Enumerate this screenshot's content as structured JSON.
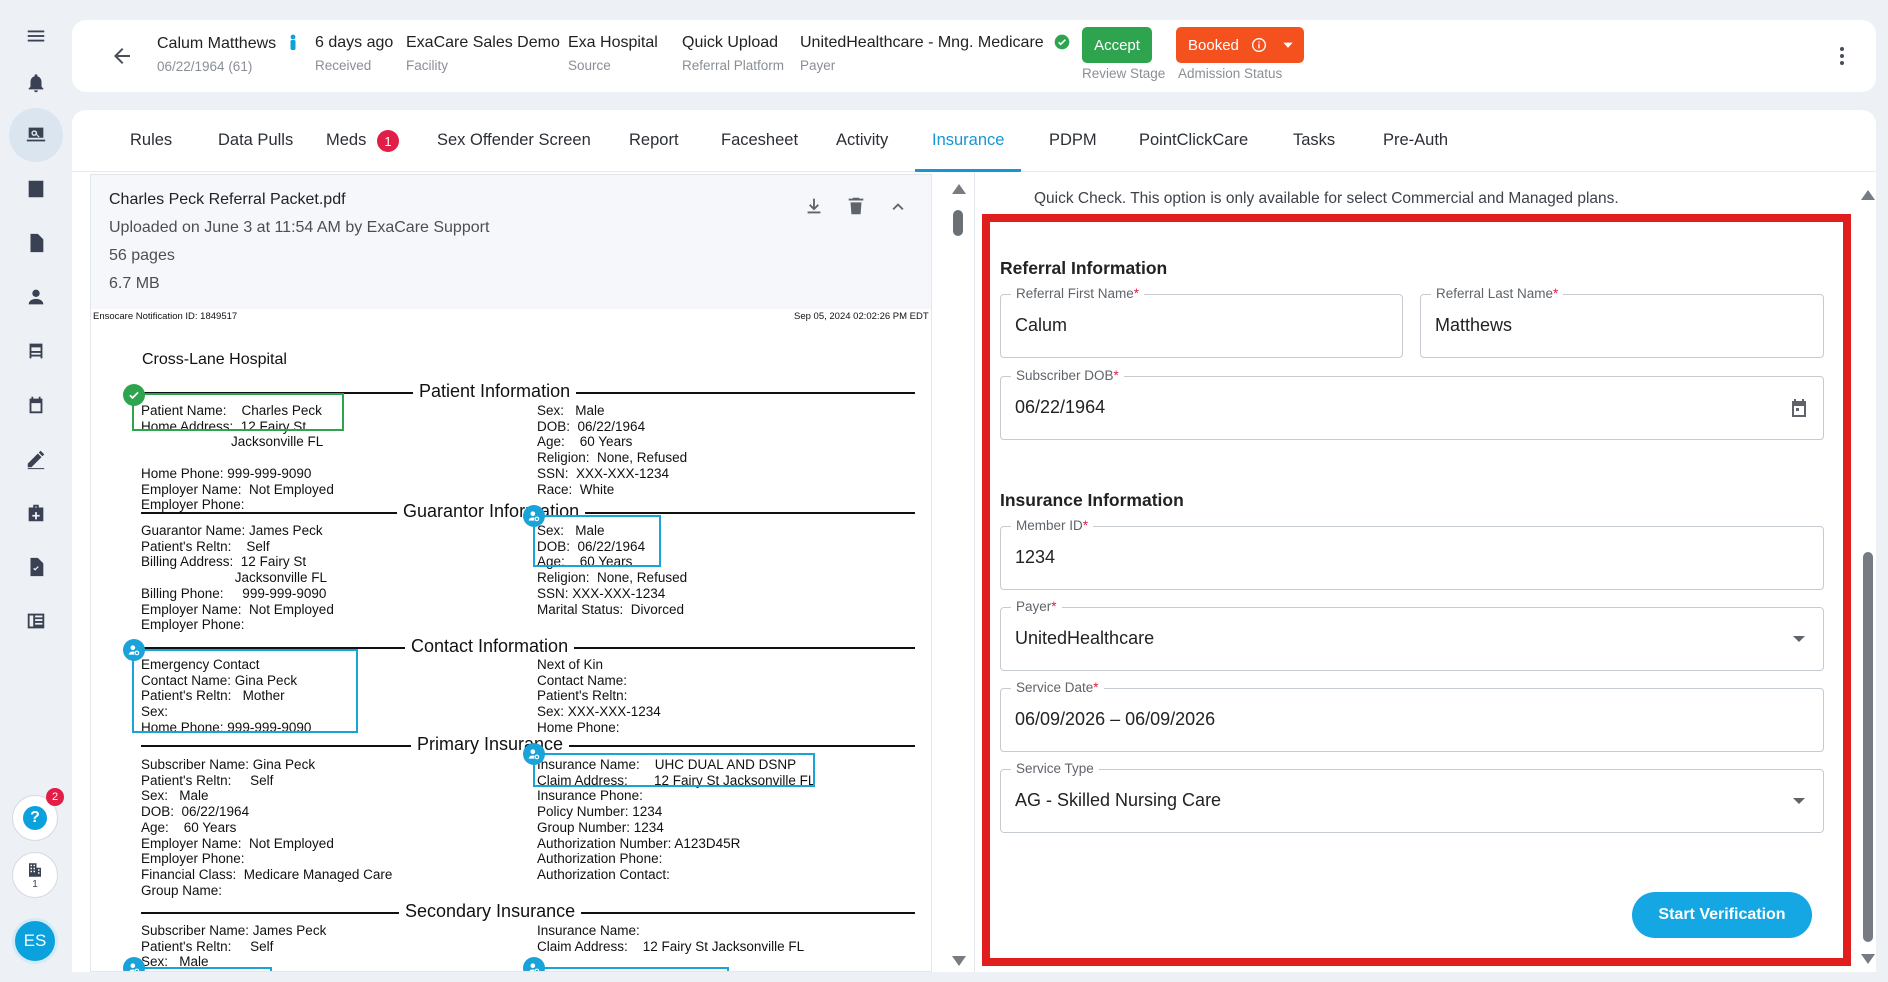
{
  "header": {
    "patient_name": "Calum Matthews",
    "patient_dob": "06/22/1964 (61)",
    "received_value": "6 days ago",
    "received_label": "Received",
    "facility_value": "ExaCare Sales Demo",
    "facility_label": "Facility",
    "source_value": "Exa Hospital",
    "source_label": "Source",
    "platform_value": "Quick Upload",
    "platform_label": "Referral Platform",
    "payer_value": "UnitedHealthcare - Mng. Medicare",
    "payer_label": "Payer",
    "accept_label": "Accept",
    "review_stage_label": "Review Stage",
    "booked_label": "Booked",
    "admission_status_label": "Admission Status"
  },
  "sidebar": {
    "help_badge": "2",
    "org_count": "1",
    "avatar_initials": "ES"
  },
  "tabs": [
    {
      "label": "Rules"
    },
    {
      "label": "Data Pulls"
    },
    {
      "label": "Meds",
      "badge": "1"
    },
    {
      "label": "Sex Offender Screen"
    },
    {
      "label": "Report"
    },
    {
      "label": "Facesheet"
    },
    {
      "label": "Activity"
    },
    {
      "label": "Insurance",
      "active": true
    },
    {
      "label": "PDPM"
    },
    {
      "label": "PointClickCare"
    },
    {
      "label": "Tasks"
    },
    {
      "label": "Pre-Auth"
    }
  ],
  "pdf": {
    "filename": "Charles Peck Referral Packet.pdf",
    "uploaded": "Uploaded on June 3 at 11:54 AM by ExaCare Support",
    "pages": "56 pages",
    "size": "6.7 MB",
    "notif_id": "Ensocare Notification ID: 1849517",
    "notif_date": "Sep 05, 2024 02:02:26 PM EDT",
    "hospital": "Cross-Lane Hospital",
    "sections": {
      "patient": "Patient Information",
      "guarantor": "Guarantor Information",
      "contact": "Contact Information",
      "primary": "Primary Insurance",
      "secondary": "Secondary Insurance"
    },
    "patient_left": "Patient Name:    Charles Peck\nHome Address:  12 Fairy St\n                        Jacksonville FL\n\nHome Phone: 999-999-9090\nEmployer Name:  Not Employed\nEmployer Phone:",
    "patient_right": "Sex:   Male\nDOB:  06/22/1964\nAge:    60 Years\nReligion:  None, Refused\nSSN:  XXX-XXX-1234\nRace:  White",
    "guarantor_left": "Guarantor Name: James Peck\nPatient's Reltn:    Self\nBilling Address:  12 Fairy St\n                         Jacksonville FL\nBilling Phone:     999-999-9090\nEmployer Name:  Not Employed\nEmployer Phone:",
    "guarantor_right": "Sex:   Male\nDOB:  06/22/1964\nAge:    60 Years\nReligion:  None, Refused\nSSN: XXX-XXX-1234\nMarital Status:  Divorced",
    "contact_left": "Emergency Contact\nContact Name: Gina Peck\nPatient's Reltn:   Mother\nSex:\nHome Phone: 999-999-9090",
    "contact_right": "Next of Kin\nContact Name:\nPatient's Reltn:\nSex: XXX-XXX-1234\nHome Phone:",
    "primary_left": "Subscriber Name: Gina Peck\nPatient's Reltn:     Self\nSex:   Male\nDOB:  06/22/1964\nAge:    60 Years\nEmployer Name:  Not Employed\nEmployer Phone:\nFinancial Class:  Medicare Managed Care\nGroup Name:",
    "primary_right": "Insurance Name:    UHC DUAL AND DSNP\nClaim Address:       12 Fairy St Jacksonville FL\nInsurance Phone:\nPolicy Number: 1234\nGroup Number: 1234\nAuthorization Number: A123D45R\nAuthorization Phone:\nAuthorization Contact:",
    "secondary_left": "Subscriber Name: James Peck\nPatient's Reltn:     Self\nSex:   Male",
    "secondary_right": "Insurance Name:\nClaim Address:    12 Fairy St Jacksonville FL"
  },
  "insurance": {
    "quick_check_note": "Quick Check. This option is only available for select Commercial and Managed plans.",
    "referral_heading": "Referral Information",
    "first_name_label": "Referral First Name",
    "first_name_value": "Calum",
    "last_name_label": "Referral Last Name",
    "last_name_value": "Matthews",
    "dob_label": "Subscriber DOB",
    "dob_value": "06/22/1964",
    "insurance_heading": "Insurance Information",
    "member_id_label": "Member ID",
    "member_id_value": "1234",
    "payer_label": "Payer",
    "payer_value": "UnitedHealthcare",
    "service_date_label": "Service Date",
    "service_date_value": "06/09/2026 – 06/09/2026",
    "service_type_label": "Service Type",
    "service_type_value": "AG - Skilled Nursing Care",
    "required_mark": "*",
    "start_button": "Start Verification"
  },
  "colors": {
    "accent": "#1796d5",
    "accept_green": "#2ea44f",
    "booked_orange": "#f4511e",
    "highlight_red": "#e01e1e",
    "badge_red": "#e11d48"
  }
}
